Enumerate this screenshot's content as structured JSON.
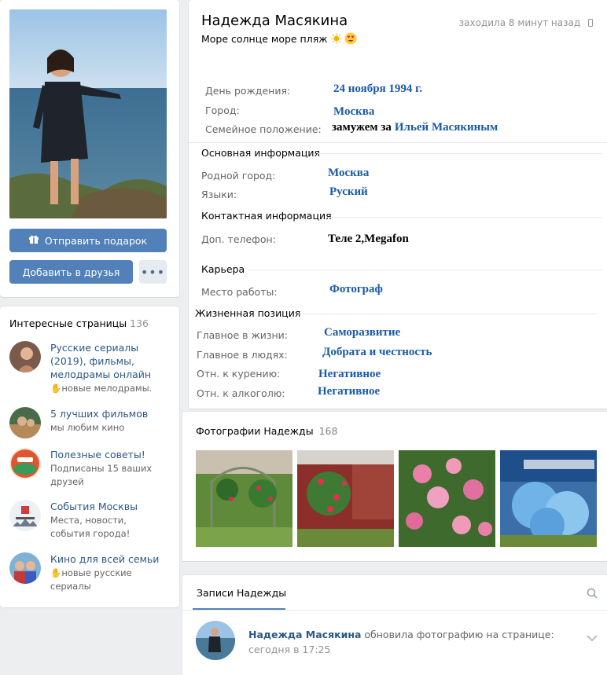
{
  "profile": {
    "name": "Надежда Масякина",
    "status": "Море солнце море пляж",
    "last_seen": "заходила 8 минут назад",
    "actions": {
      "gift": "Отправить подарок",
      "add_friend": "Добавить в друзья",
      "more": "•••"
    },
    "details": [
      {
        "label": "День рождения:",
        "value": "24 ноября 1994 г."
      },
      {
        "label": "Город:",
        "value": "Москва"
      },
      {
        "label": "Семейное положение:",
        "value_prefix": "замужем за",
        "value": "Ильей Масякиным"
      }
    ],
    "sections": [
      {
        "title": "Основная информация",
        "rows": [
          {
            "label": "Родной город:",
            "value": "Москва"
          },
          {
            "label": "Языки:",
            "value": "Руский"
          }
        ]
      },
      {
        "title": "Контактная информация",
        "rows": [
          {
            "label": "Доп. телефон:",
            "value": "Теле 2,Megafon"
          }
        ]
      },
      {
        "title": "Карьера",
        "rows": [
          {
            "label": "Место работы:",
            "value": "Фотограф"
          }
        ]
      },
      {
        "title": "Жизненная позиция",
        "rows": [
          {
            "label": "Главное в жизни:",
            "value": "Саморазвитие"
          },
          {
            "label": "Главное в людях:",
            "value": "Добрата и честность"
          },
          {
            "label": "Отн. к курению:",
            "value": "Негативное"
          },
          {
            "label": "Отн. к алкоголю:",
            "value": "Негативное"
          }
        ]
      }
    ]
  },
  "pages": {
    "title": "Интересные страницы",
    "count": "136",
    "items": [
      {
        "name": "Русские сериалы (2019), фильмы, мелодрамы онлайн",
        "sub": "✋новые мелодрамы."
      },
      {
        "name": "5 лучших фильмов",
        "sub": "мы любим кино"
      },
      {
        "name": "Полезные советы!",
        "sub": "Подписаны 15 ваших друзей"
      },
      {
        "name": "События Москвы",
        "sub": "Места, новости, события города!"
      },
      {
        "name": "Кино для всей семьи",
        "sub": "✋новые русские сериалы"
      }
    ]
  },
  "photos": {
    "title": "Фотографии Надежды",
    "count": "168"
  },
  "posts": {
    "tab": "Записи Надежды",
    "author": "Надежда Масякина",
    "action": "обновила фотографию на странице:",
    "time": "сегодня в 17:25"
  },
  "colors": {
    "accent": "#5181b8",
    "link": "#2a5885",
    "value_serif": "#1a5aa6",
    "background": "#edeef0"
  }
}
